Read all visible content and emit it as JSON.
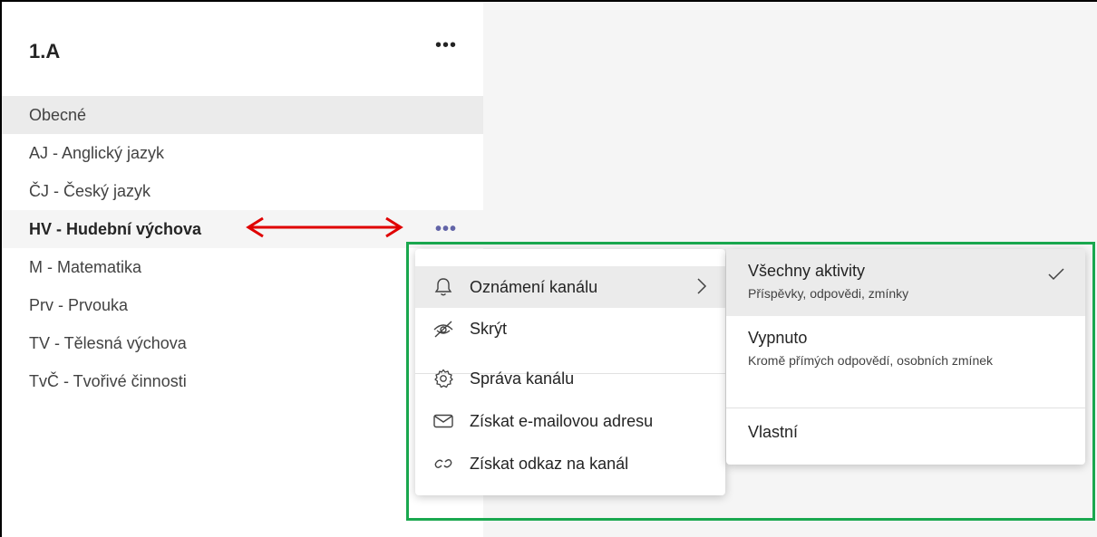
{
  "team": {
    "name": "1.A",
    "more_label": "•••"
  },
  "channels": [
    {
      "label": "Obecné"
    },
    {
      "label": "AJ - Anglický jazyk"
    },
    {
      "label": "ČJ - Český jazyk"
    },
    {
      "label": "HV - Hudební výchova",
      "more_label": "•••"
    },
    {
      "label": "M - Matematika"
    },
    {
      "label": "Prv - Prvouka"
    },
    {
      "label": "TV - Tělesná výchova"
    },
    {
      "label": "TvČ - Tvořivé činnosti"
    }
  ],
  "context_menu": {
    "items": [
      {
        "label": "Oznámení kanálu",
        "icon": "bell-icon"
      },
      {
        "label": "Skrýt",
        "icon": "eye-off-icon"
      },
      {
        "label": "Správa kanálu",
        "icon": "gear-icon"
      },
      {
        "label": "Získat e-mailovou adresu",
        "icon": "mail-icon"
      },
      {
        "label": "Získat odkaz na kanál",
        "icon": "link-icon"
      }
    ]
  },
  "notification_submenu": {
    "items": [
      {
        "title": "Všechny aktivity",
        "desc": "Příspěvky, odpovědi, zmínky",
        "checked": true
      },
      {
        "title": "Vypnuto",
        "desc": "Kromě přímých odpovědí, osobních zmínek"
      },
      {
        "title": "Vlastní"
      }
    ]
  },
  "annotation": {
    "arrow_color": "#e00000",
    "box_color": "#1aa84f"
  }
}
